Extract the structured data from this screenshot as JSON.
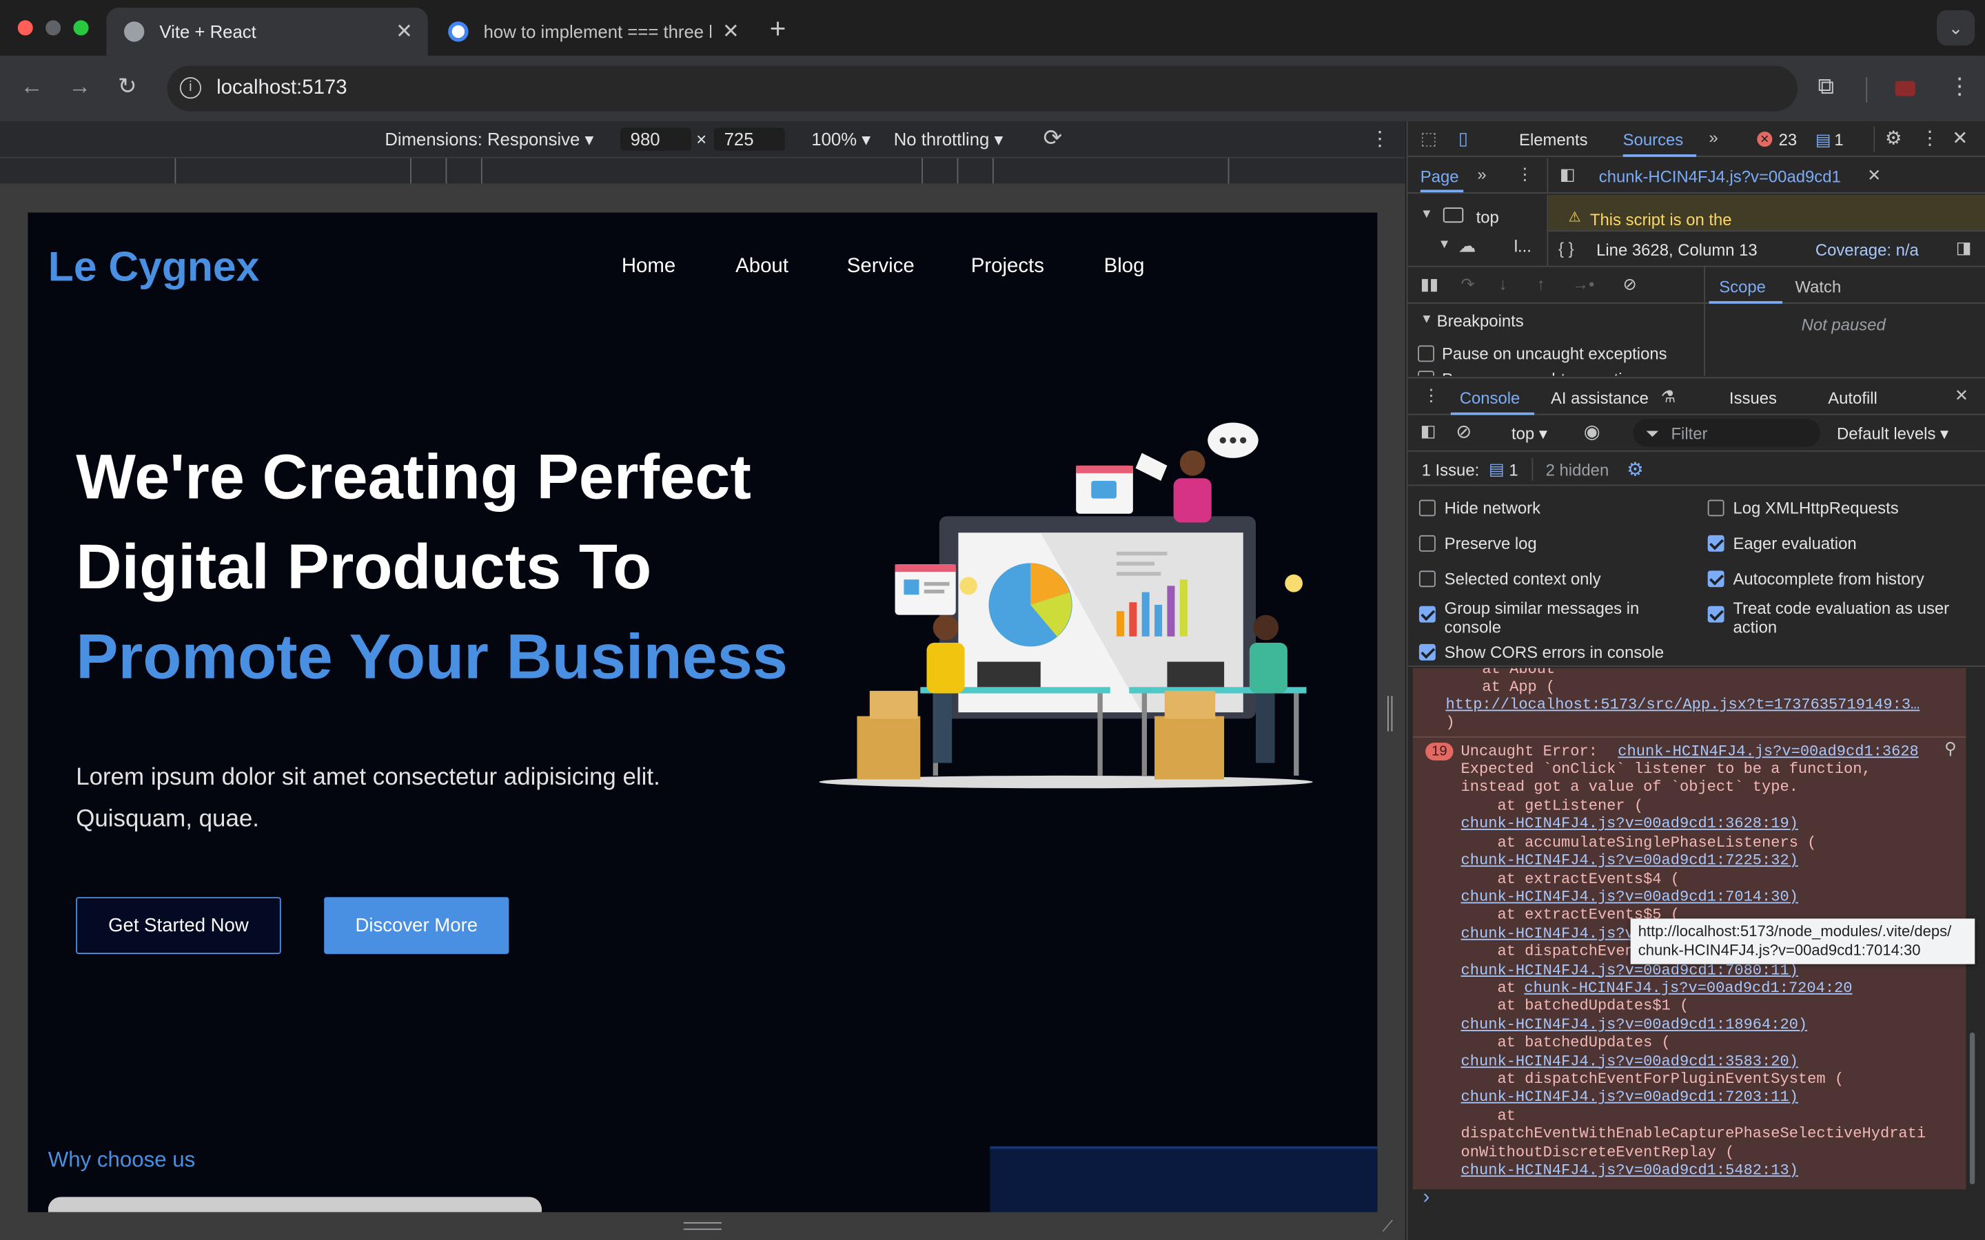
{
  "browser": {
    "tabs": [
      {
        "title": "Vite + React",
        "active": true
      },
      {
        "title": "how to implement === three l",
        "active": false
      }
    ],
    "url": "localhost:5173"
  },
  "device_toolbar": {
    "dimensions_label": "Dimensions: Responsive",
    "width": "980",
    "height": "725",
    "zoom": "100%",
    "throttling": "No throttling"
  },
  "site": {
    "logo": "Le Cygnex",
    "nav": [
      "Home",
      "About",
      "Service",
      "Projects",
      "Blog"
    ],
    "hero": {
      "line1": "We're Creating Perfect",
      "line2": "Digital Products To",
      "line3": "Promote Your Business",
      "description_line1": "Lorem ipsum dolor sit amet consectetur adipisicing elit.",
      "description_line2": "Quisquam, quae.",
      "primary_button": "Get Started Now",
      "secondary_button": "Discover More"
    },
    "section_label": "Why choose us",
    "colors": {
      "accent": "#4a90e2",
      "background": "#03050f",
      "button_secondary": "#4a90e2"
    }
  },
  "devtools": {
    "tabs": [
      "Elements",
      "Sources"
    ],
    "error_count": "23",
    "message_count": "1",
    "sources": {
      "page_tab": "Page",
      "file_tab": "chunk-HCIN4FJ4.js?v=00ad9cd1",
      "tree_top": "top",
      "tree_child": "l...",
      "warning": "This script is on the",
      "position": "Line 3628, Column 13",
      "coverage": "Coverage: n/a",
      "scope_tab": "Scope",
      "watch_tab": "Watch",
      "not_paused": "Not paused",
      "breakpoints_header": "Breakpoints",
      "pause_uncaught": "Pause on uncaught exceptions",
      "pause_caught": "Pause on caught exceptions"
    },
    "drawer_tabs": [
      "Console",
      "AI assistance",
      "Issues",
      "Autofill"
    ],
    "console": {
      "context": "top",
      "filter_placeholder": "Filter",
      "levels": "Default levels",
      "issues_label": "1 Issue:",
      "issues_count": "1",
      "hidden": "2 hidden",
      "settings": {
        "left": [
          {
            "label": "Hide network",
            "checked": false
          },
          {
            "label": "Preserve log",
            "checked": false
          },
          {
            "label": "Selected context only",
            "checked": false
          },
          {
            "label": "Group similar messages in console",
            "checked": true
          },
          {
            "label": "Show CORS errors in console",
            "checked": true
          }
        ],
        "right": [
          {
            "label": "Log XMLHttpRequests",
            "checked": false
          },
          {
            "label": "Eager evaluation",
            "checked": true
          },
          {
            "label": "Autocomplete from history",
            "checked": true
          },
          {
            "label": "Treat code evaluation as user action",
            "checked": true
          }
        ]
      },
      "prev_lines": [
        "    at About",
        "    at App (",
        "http://localhost:5173/src/App.jsx?t=1737635719149:3…",
        ")"
      ],
      "error": {
        "repeat": "19",
        "title": "Uncaught Error:",
        "source_link": "chunk-HCIN4FJ4.js?v=00ad9cd1:3628",
        "message_line1": "Expected `onClick` listener to be a function,",
        "message_line2": "instead got a value of `object` type.",
        "stack": [
          {
            "fn": "    at getListener (",
            "loc": "chunk-HCIN4FJ4.js?v=00ad9cd1:3628:19"
          },
          {
            "fn": "    at accumulateSinglePhaseListeners (",
            "loc": "chunk-HCIN4FJ4.js?v=00ad9cd1:7225:32"
          },
          {
            "fn": "    at extractEvents$4 (",
            "loc": "chunk-HCIN4FJ4.js?v=00ad9cd1:7014:30"
          },
          {
            "fn": "    at extractEvents$5 (",
            "loc": "chunk-HCIN4FJ4.js?v"
          },
          {
            "fn": "    at dispatchEvent",
            "loc": "chunk-HCIN4FJ4.js?v=00ad9cd1:7080:11"
          },
          {
            "fn": "    at ",
            "loc": "chunk-HCIN4FJ4.js?v=00ad9cd1:7204:20"
          },
          {
            "fn": "    at batchedUpdates$1 (",
            "loc": "chunk-HCIN4FJ4.js?v=00ad9cd1:18964:20"
          },
          {
            "fn": "    at batchedUpdates (",
            "loc": "chunk-HCIN4FJ4.js?v=00ad9cd1:3583:20"
          },
          {
            "fn": "    at dispatchEventForPluginEventSystem (",
            "loc": "chunk-HCIN4FJ4.js?v=00ad9cd1:7203:11"
          },
          {
            "fn": "    at",
            "loc": ""
          },
          {
            "fn": "dispatchEventWithEnableCapturePhaseSelectiveHydrati",
            "loc": ""
          },
          {
            "fn": "onWithoutDiscreteEventReplay (",
            "loc": "chunk-HCIN4FJ4.js?v=00ad9cd1:5482:13"
          }
        ]
      },
      "tooltip_line1": "http://localhost:5173/node_modules/.vite/deps/",
      "tooltip_line2": "chunk-HCIN4FJ4.js?v=00ad9cd1:7014:30",
      "prompt": "›"
    }
  }
}
